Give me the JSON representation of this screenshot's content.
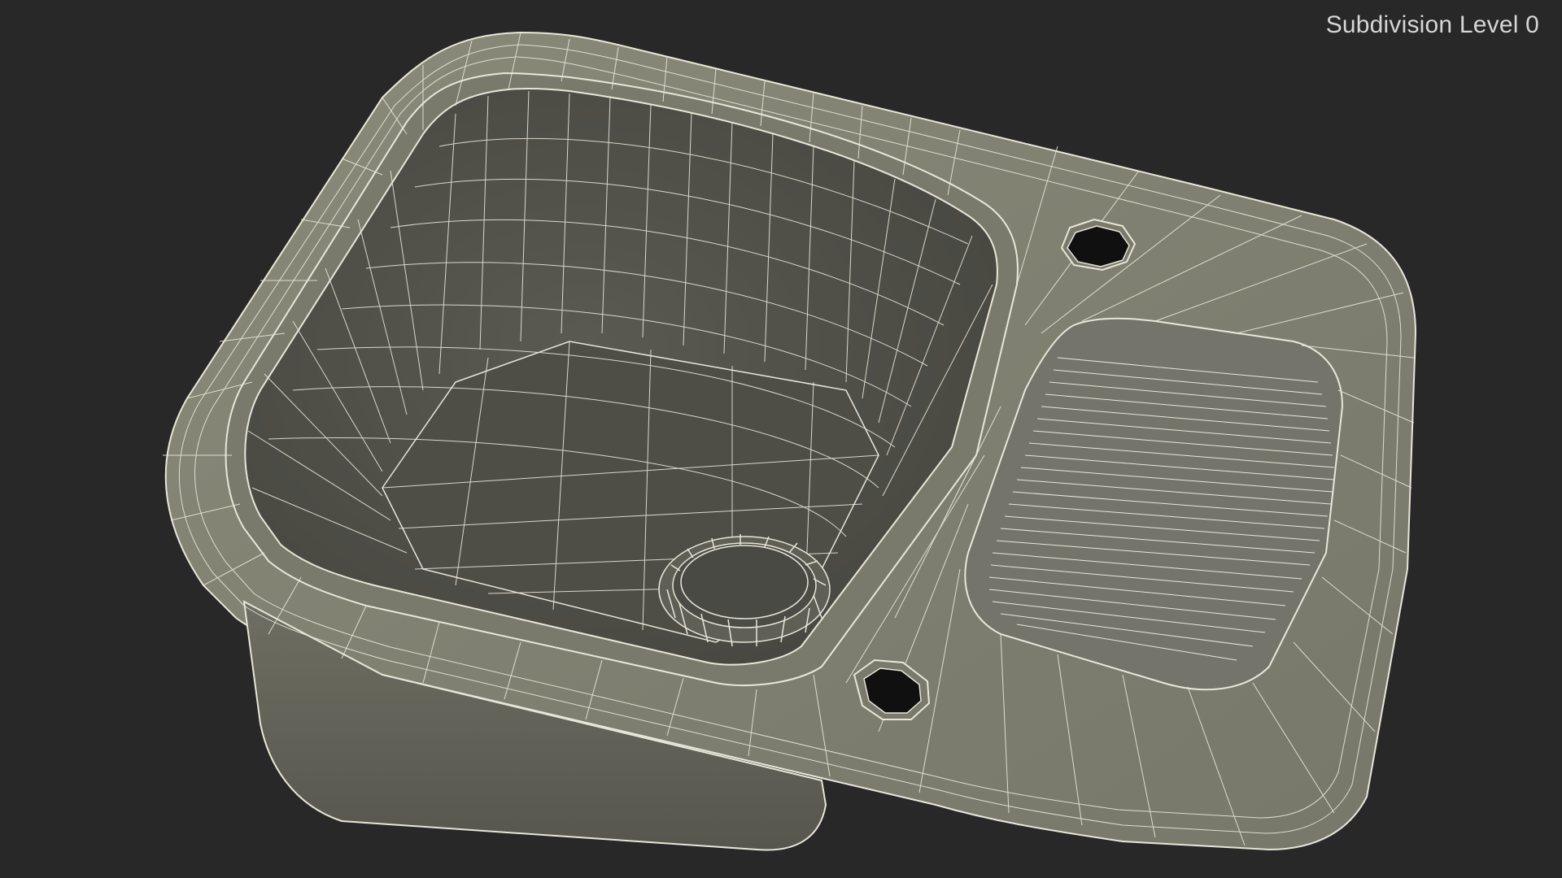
{
  "viewport": {
    "subdivision_label": "Subdivision Level 0",
    "background_color": "#282828",
    "mesh_color": "#7c7c6c",
    "wire_color": "#e8e6d8"
  }
}
